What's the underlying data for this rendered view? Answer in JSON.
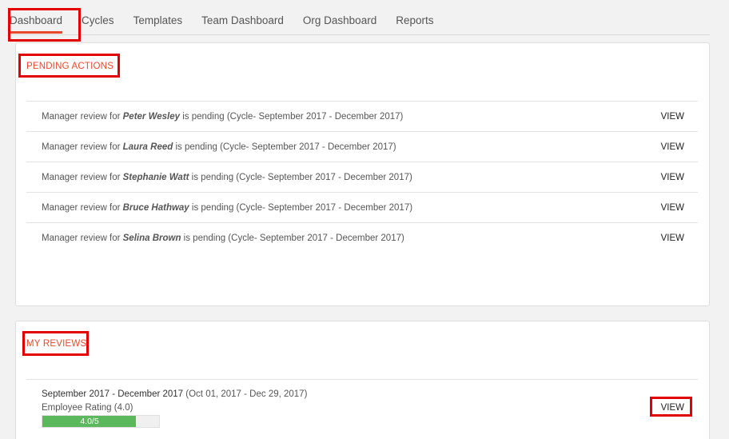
{
  "tabs": [
    {
      "label": "Dashboard",
      "active": true
    },
    {
      "label": "Cycles"
    },
    {
      "label": "Templates"
    },
    {
      "label": "Team Dashboard"
    },
    {
      "label": "Org Dashboard"
    },
    {
      "label": "Reports"
    }
  ],
  "pending": {
    "title": "PENDING ACTIONS",
    "items": [
      {
        "prefix": "Manager review for ",
        "name": "Peter Wesley",
        "suffix": " is pending (Cycle- September 2017 - December 2017)",
        "action": "VIEW"
      },
      {
        "prefix": "Manager review for ",
        "name": "Laura Reed",
        "suffix": " is pending (Cycle- September 2017 - December 2017)",
        "action": "VIEW"
      },
      {
        "prefix": "Manager review for ",
        "name": "Stephanie Watt",
        "suffix": " is pending (Cycle- September 2017 - December 2017)",
        "action": "VIEW"
      },
      {
        "prefix": "Manager review for ",
        "name": "Bruce Hathway",
        "suffix": " is pending (Cycle- September 2017 - December 2017)",
        "action": "VIEW"
      },
      {
        "prefix": "Manager review for ",
        "name": "Selina Brown",
        "suffix": " is pending (Cycle- September 2017 - December 2017)",
        "action": "VIEW"
      }
    ]
  },
  "reviews": {
    "title": "MY REVIEWS",
    "items": [
      {
        "cycle": "September 2017 - December 2017",
        "dates": " (Oct 01, 2017 - Dec 29, 2017)",
        "rating_label": "Employee Rating (4.0)",
        "rating_text": "4.0/5",
        "rating_fraction": 0.8,
        "action": "VIEW"
      }
    ]
  },
  "colors": {
    "accent": "#e8492b",
    "highlight": "#e30000",
    "progress": "#5cb85c"
  }
}
